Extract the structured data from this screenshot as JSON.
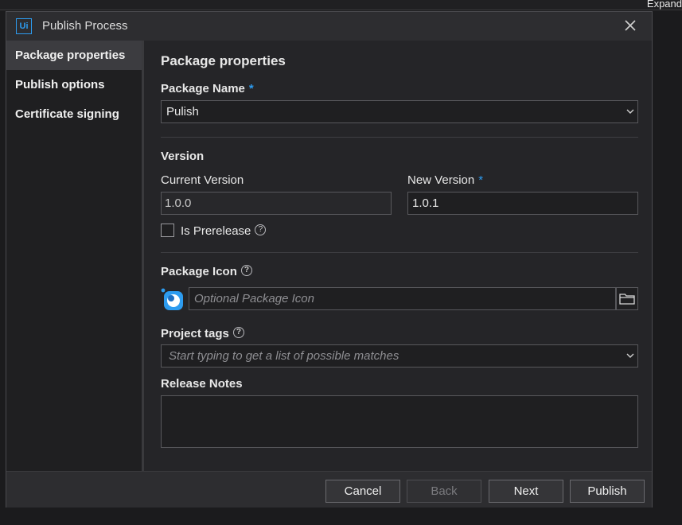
{
  "background": {
    "right_edge_text": "Expand"
  },
  "dialog": {
    "logo_text": "Ui",
    "title": "Publish Process"
  },
  "sidebar": {
    "items": [
      {
        "label": "Package properties",
        "active": true
      },
      {
        "label": "Publish options",
        "active": false
      },
      {
        "label": "Certificate signing",
        "active": false
      }
    ]
  },
  "main": {
    "heading": "Package properties",
    "package_name": {
      "label": "Package Name",
      "required_mark": "*",
      "value": "Pulish"
    },
    "version": {
      "heading": "Version",
      "current_label": "Current Version",
      "current_value": "1.0.0",
      "new_label": "New Version",
      "new_required_mark": "*",
      "new_value": "1.0.1",
      "prerelease_label": "Is Prerelease",
      "prerelease_checked": false
    },
    "package_icon": {
      "label": "Package Icon",
      "placeholder": "Optional Package Icon"
    },
    "project_tags": {
      "label": "Project tags",
      "placeholder": "Start typing to get a list of possible matches"
    },
    "release_notes": {
      "label": "Release Notes",
      "value": ""
    },
    "help_glyph": "?"
  },
  "footer": {
    "cancel": "Cancel",
    "back": "Back",
    "next": "Next",
    "publish": "Publish"
  },
  "colors": {
    "accent": "#2d9cf0",
    "background": "#252528",
    "sidebar_active": "#3c3c40"
  },
  "icons": [
    "ui-logo-icon",
    "close-icon",
    "chevron-down-icon",
    "help-icon",
    "package-icon",
    "folder-icon"
  ]
}
